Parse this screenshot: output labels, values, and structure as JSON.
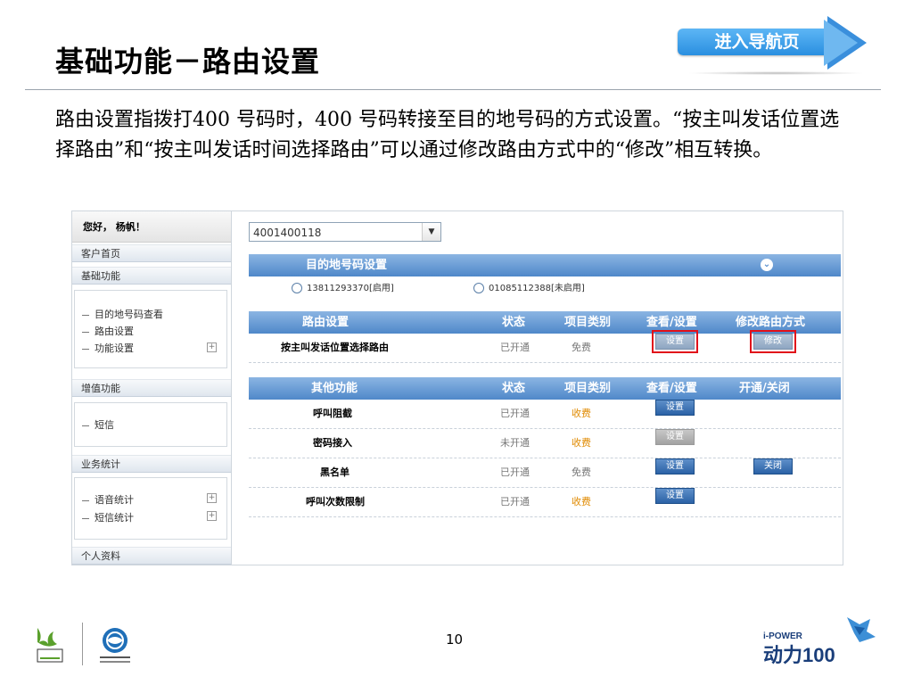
{
  "slide": {
    "title": "基础功能－路由设置",
    "nav_button": "进入导航页",
    "description": "路由设置指拨打400 号码时，400 号码转接至目的地号码的方式设置。“按主叫发话位置选择路由”和“按主叫发话时间选择路由”可以通过修改路由方式中的“修改”相互转换。",
    "page_number": "10"
  },
  "sidebar": {
    "greeting": "您好， 杨帆！",
    "home": "客户首页",
    "basic": {
      "label": "基础功能",
      "items": [
        "目的地号码查看",
        "路由设置",
        "功能设置"
      ]
    },
    "value_added": {
      "label": "增值功能",
      "items": [
        "短信"
      ]
    },
    "stats": {
      "label": "业务统计",
      "items": [
        "语音统计",
        "短信统计"
      ]
    },
    "profile": "个人资料"
  },
  "main": {
    "number_select": "4001400118",
    "dest": {
      "header": "目的地号码设置",
      "options": [
        "13811293370[启用]",
        "01085112388[未启用]"
      ]
    },
    "route_table": {
      "headers": [
        "路由设置",
        "状态",
        "项目类别",
        "查看/设置",
        "修改路由方式"
      ],
      "row": {
        "name": "按主叫发话位置选择路由",
        "status": "已开通",
        "category": "免费",
        "set": "设置",
        "modify": "修改"
      }
    },
    "other_table": {
      "headers": [
        "其他功能",
        "状态",
        "项目类别",
        "查看/设置",
        "开通/关闭"
      ],
      "rows": [
        {
          "name": "呼叫阻截",
          "status": "已开通",
          "category": "收费",
          "set": "设置",
          "toggle": ""
        },
        {
          "name": "密码接入",
          "status": "未开通",
          "category": "收费",
          "set": "设置",
          "toggle": ""
        },
        {
          "name": "黑名单",
          "status": "已开通",
          "category": "免费",
          "set": "设置",
          "toggle": "关闭"
        },
        {
          "name": "呼叫次数限制",
          "status": "已开通",
          "category": "收费",
          "set": "设置",
          "toggle": ""
        }
      ]
    }
  },
  "footer": {
    "logo_left": "expo-2010-logo",
    "logo_mid": "china-mobile-logo",
    "logo_right_text": "i-POWER",
    "logo_right_brand": "动力100"
  },
  "colors": {
    "accent": "#4f88c9",
    "highlight": "#e1101a",
    "charge": "#e08a00"
  }
}
